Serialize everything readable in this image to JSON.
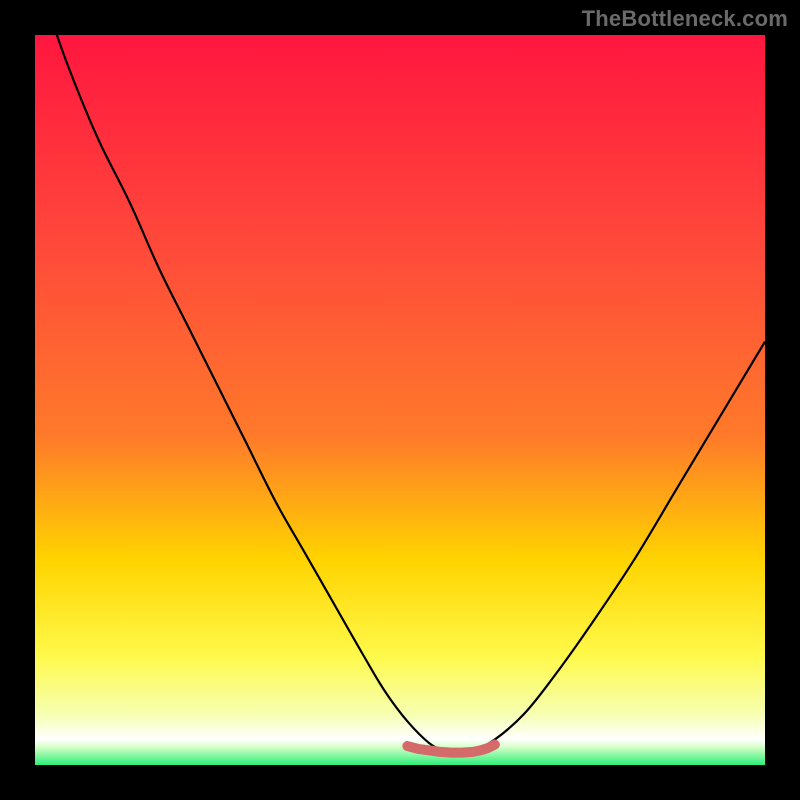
{
  "watermark": "TheBottleneck.com",
  "colors": {
    "bg_black": "#000000",
    "grad_top": "#ff163f",
    "grad_mid1": "#ff7a2a",
    "grad_mid2": "#ffd400",
    "grad_low1": "#fff94a",
    "grad_low2": "#f6ffb0",
    "grad_bottom": "#2cf07a",
    "curve": "#000000",
    "marker": "#d46a6a"
  },
  "chart_data": {
    "type": "line",
    "title": "",
    "xlabel": "",
    "ylabel": "",
    "xlim": [
      0,
      100
    ],
    "ylim": [
      0,
      100
    ],
    "series": [
      {
        "name": "bottleneck-curve",
        "x": [
          0,
          3,
          6,
          9,
          13,
          17,
          21,
          25,
          29,
          33,
          37,
          41,
          45,
          48,
          51,
          54,
          56,
          58,
          60,
          63,
          67,
          71,
          76,
          82,
          88,
          94,
          100
        ],
        "y": [
          110,
          100,
          92,
          85,
          77,
          68,
          60,
          52,
          44,
          36,
          29,
          22,
          15,
          10,
          6,
          3,
          2,
          1.5,
          2,
          3.5,
          7,
          12,
          19,
          28,
          38,
          48,
          58
        ]
      }
    ],
    "markers": {
      "name": "optimal-band",
      "x": [
        51,
        52.5,
        54,
        55.5,
        57,
        58.5,
        60,
        61,
        62,
        63
      ],
      "y": [
        2.6,
        2.2,
        2.0,
        1.8,
        1.7,
        1.7,
        1.8,
        2.0,
        2.3,
        2.8
      ]
    },
    "gradient_stops": [
      {
        "offset": 0,
        "note": "top (red)"
      },
      {
        "offset": 55,
        "note": "orange"
      },
      {
        "offset": 78,
        "note": "yellow"
      },
      {
        "offset": 90,
        "note": "pale yellow"
      },
      {
        "offset": 97,
        "note": "near-white band"
      },
      {
        "offset": 100,
        "note": "green bottom"
      }
    ]
  }
}
